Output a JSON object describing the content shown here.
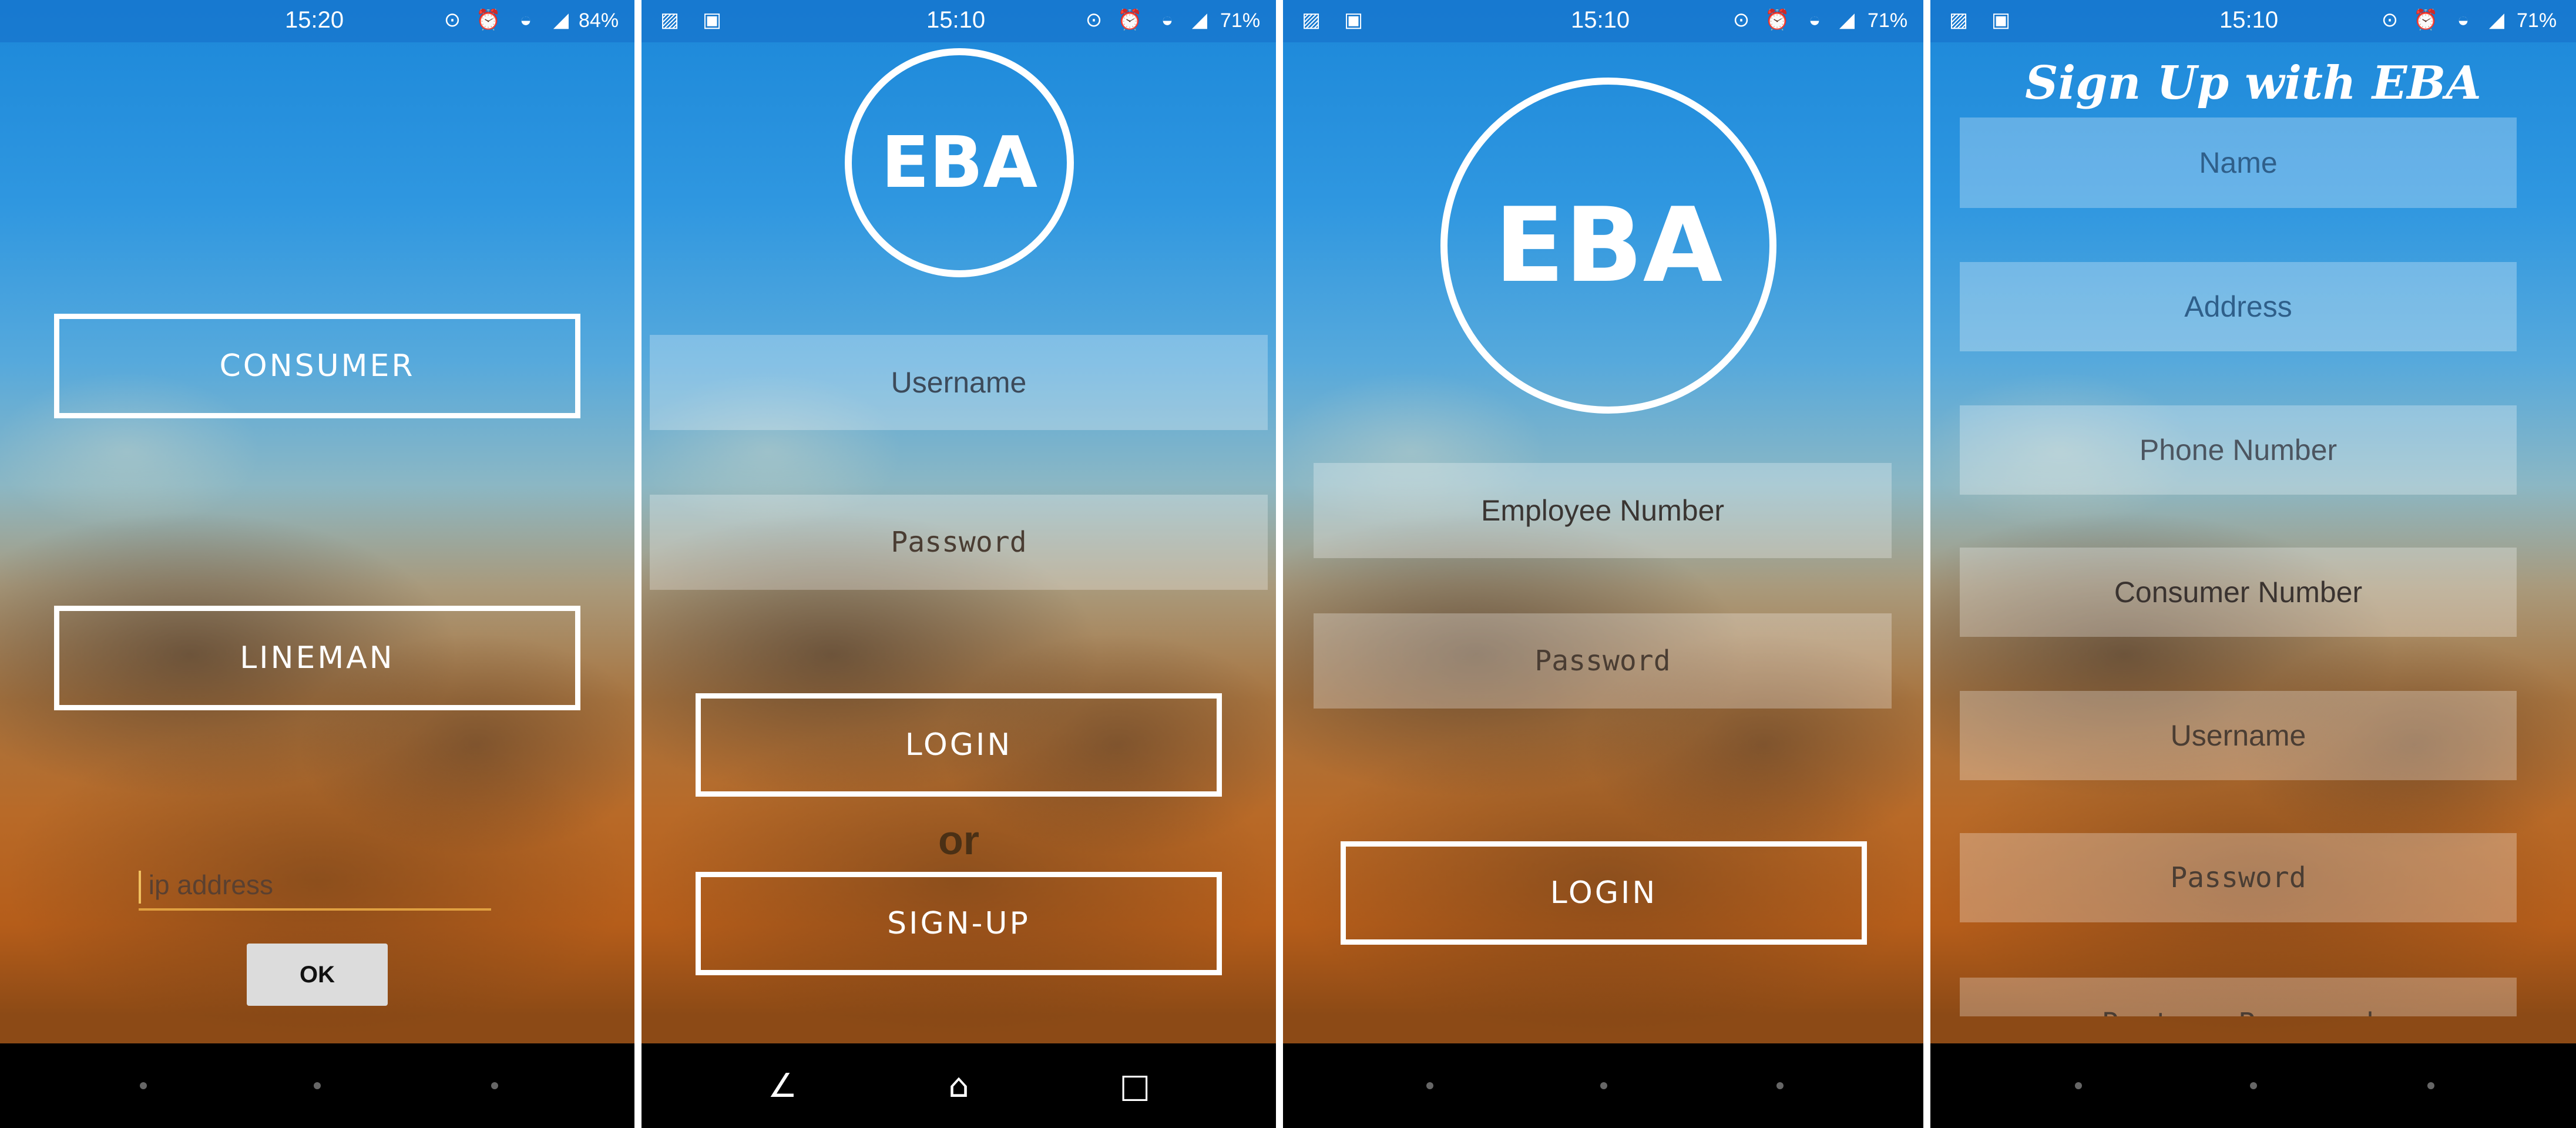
{
  "screens": [
    {
      "status_time": "15:20",
      "battery": "84%",
      "buttons": {
        "consumer": "CONSUMER",
        "lineman": "LINEMAN",
        "ok": "OK"
      },
      "ip_placeholder": "ip address"
    },
    {
      "status_time": "15:10",
      "battery": "71%",
      "logo": "EBA",
      "username_placeholder": "Username",
      "password_placeholder": "Password",
      "login": "LOGIN",
      "or": "or",
      "signup": "SIGN-UP"
    },
    {
      "status_time": "15:10",
      "battery": "71%",
      "logo": "EBA",
      "employee_placeholder": "Employee Number",
      "password_placeholder": "Password",
      "login": "LOGIN"
    },
    {
      "status_time": "15:10",
      "battery": "71%",
      "title": "Sign Up with EBA",
      "fields": [
        "Name",
        "Address",
        "Phone Number",
        "Consumer Number",
        "Username",
        "Password",
        "Re-type Password"
      ]
    }
  ],
  "icons": [
    "sync-icon",
    "alarm-icon",
    "wifi-icon",
    "signal-icon",
    "battery-icon",
    "image-icon",
    "bag-icon",
    "back-icon",
    "home-icon",
    "recents-icon"
  ],
  "colors": {
    "accent": "#ffffff",
    "sky_top": "#1b87d9",
    "sunset": "#b86a28"
  }
}
